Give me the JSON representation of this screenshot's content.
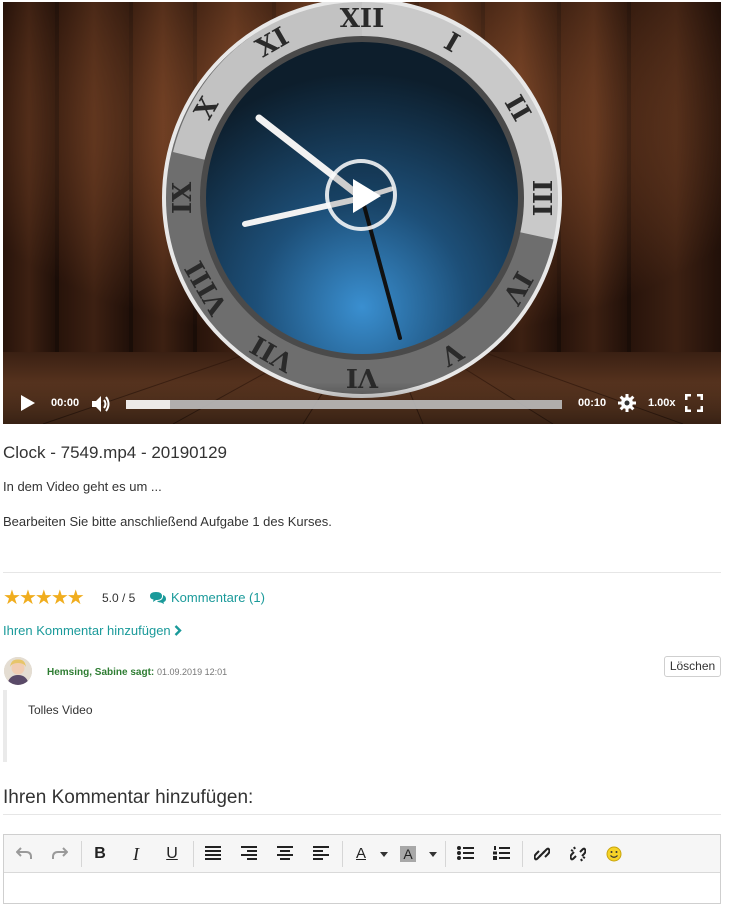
{
  "player": {
    "current_time": "00:00",
    "duration": "00:10",
    "speed": "1.00x",
    "progress_fraction": 0.1,
    "clock_numerals": [
      "XII",
      "I",
      "II",
      "III",
      "IV",
      "V",
      "VI",
      "VII",
      "VIII",
      "IX",
      "X",
      "XI"
    ]
  },
  "video": {
    "title": "Clock - 7549.mp4 - 20190129",
    "description": "In dem Video geht es um ...",
    "task": "Bearbeiten Sie bitte anschließend Aufgabe 1 des Kurses."
  },
  "rating": {
    "stars": 5,
    "score_text": "5.0 / 5",
    "comments_link": "Kommentare (1)",
    "star_color": "#f0ad1e"
  },
  "add_comment_link": "Ihren Kommentar hinzufügen",
  "comment": {
    "author": "Hemsing, Sabine sagt:",
    "date": "01.09.2019 12:01",
    "text": "Tolles Video",
    "delete_label": "Löschen"
  },
  "add_comment_heading": "Ihren Kommentar hinzufügen:",
  "editor": {
    "tools": [
      "undo-icon",
      "redo-icon",
      "bold-icon",
      "italic-icon",
      "underline-icon",
      "align-justify-icon",
      "align-right-icon",
      "align-center-icon",
      "align-left-icon",
      "text-color-icon",
      "background-color-icon",
      "bullet-list-icon",
      "numbered-list-icon",
      "link-icon",
      "unlink-icon",
      "emoticon-icon"
    ],
    "bold_glyph": "B",
    "italic_glyph": "I",
    "underline_glyph": "U",
    "text_color_glyph": "A",
    "bg_color_glyph": "A"
  },
  "colors": {
    "link": "#1a9a9a",
    "author": "#2e7d32"
  }
}
